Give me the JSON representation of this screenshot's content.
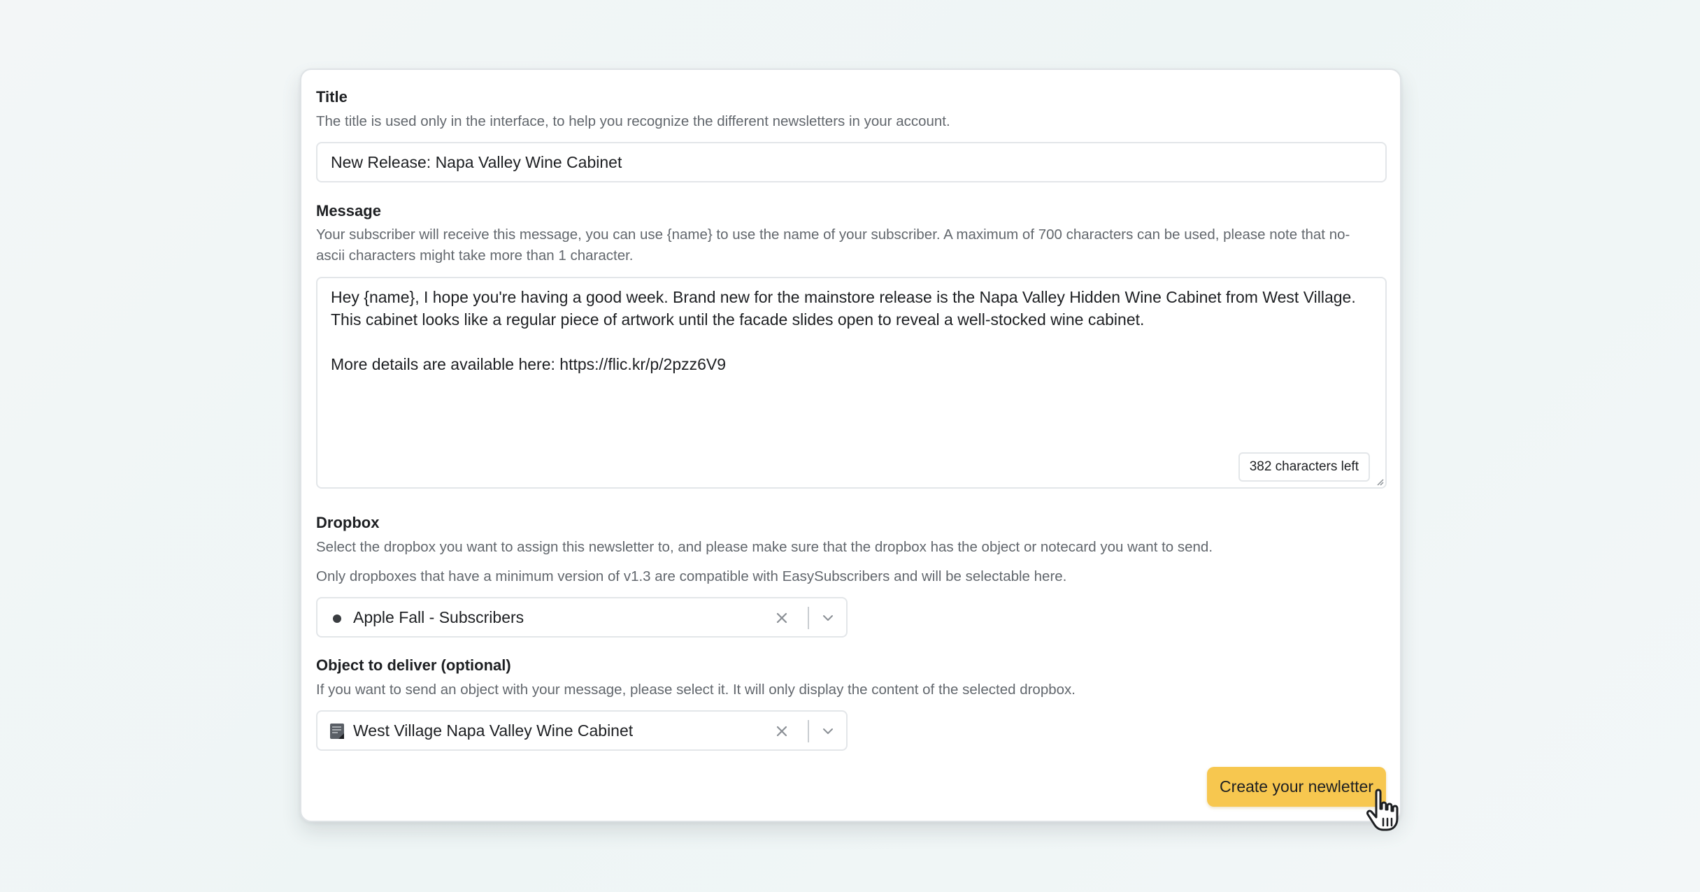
{
  "form": {
    "title": {
      "label": "Title",
      "help": "The title is used only in the interface, to help you recognize the different newsletters in your account.",
      "value": "New Release: Napa Valley Wine Cabinet"
    },
    "message": {
      "label": "Message",
      "help_line1": "Your subscriber will receive this message, you can use {name} to use the name of your subscriber. A maximum of 700 characters can be used, please note that no-",
      "help_line2": "ascii characters might take more than 1 character.",
      "lines": [
        "Hey {name}, I hope you're having a good week. Brand new for the mainstore release is the Napa Valley Hidden Wine Cabinet from West Village.",
        "This cabinet looks like a regular piece of artwork until the facade slides open to reveal a well-stocked wine cabinet.",
        "",
        "More details are available here: https://flic.kr/p/2pzz6V9"
      ],
      "counter": "382 characters left"
    },
    "dropbox": {
      "label": "Dropbox",
      "help1": "Select the dropbox you want to assign this newsletter to, and please make sure that the dropbox has the object or notecard you want to send.",
      "help2": "Only dropboxes that have a minimum version of v1.3 are compatible with EasySubscribers and will be selectable here.",
      "selected": "Apple Fall - Subscribers",
      "icon": "bullet-icon"
    },
    "object": {
      "label": "Object to deliver (optional)",
      "help": "If you want to send an object with your message, please select it. It will only display the content of the selected dropbox.",
      "selected": "West Village Napa Valley Wine Cabinet",
      "icon": "notecard-icon"
    },
    "submit_label": "Create your newletter"
  },
  "colors": {
    "accent": "#f7c74f",
    "border": "#e3e6e9",
    "muted_text": "#62676d"
  }
}
